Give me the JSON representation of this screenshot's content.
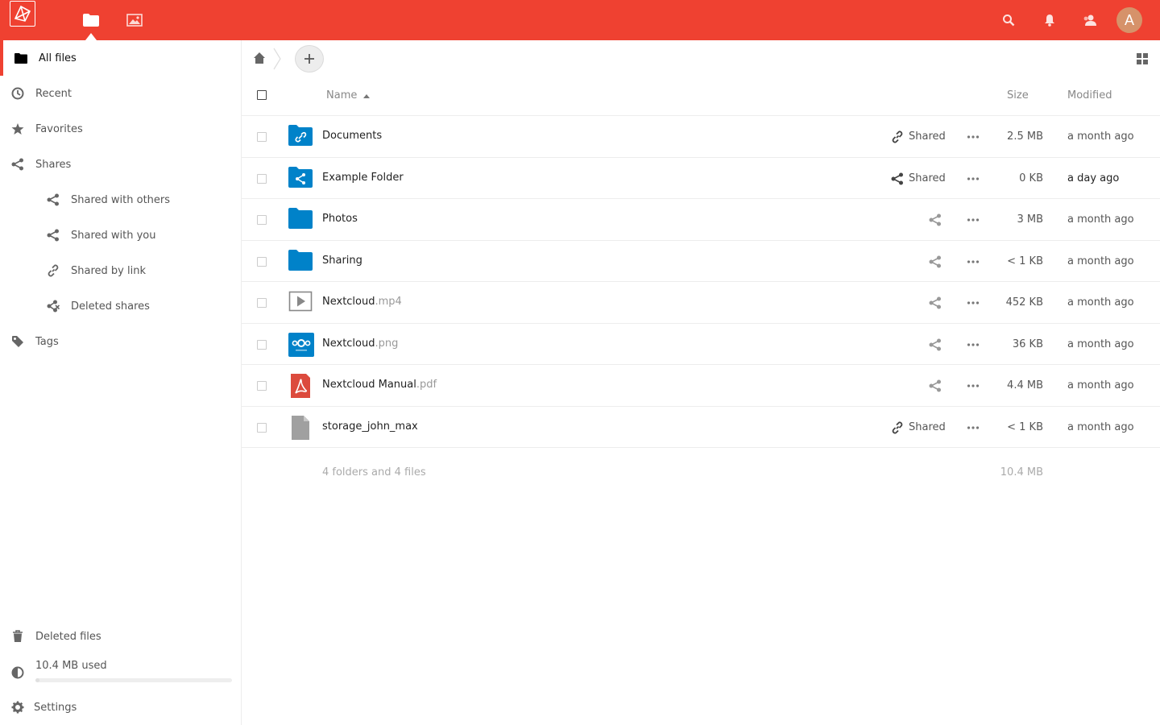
{
  "colors": {
    "brand": "#ef4131",
    "folder": "#0082c9",
    "avatar": "#d6926a"
  },
  "header": {
    "apps": [
      {
        "name": "Files",
        "icon": "folder-icon",
        "active": true
      },
      {
        "name": "Gallery",
        "icon": "image-icon",
        "active": false
      }
    ],
    "right_icons": [
      "search-icon",
      "bell-icon",
      "contacts-icon"
    ],
    "avatar_letter": "A"
  },
  "sidebar": {
    "items": [
      {
        "label": "All files",
        "icon": "folder-icon",
        "active": true
      },
      {
        "label": "Recent",
        "icon": "clock-icon"
      },
      {
        "label": "Favorites",
        "icon": "star-icon"
      },
      {
        "label": "Shares",
        "icon": "share-icon"
      },
      {
        "label": "Shared with others",
        "icon": "share-icon",
        "sub": true
      },
      {
        "label": "Shared with you",
        "icon": "share-icon",
        "sub": true
      },
      {
        "label": "Shared by link",
        "icon": "link-icon",
        "sub": true
      },
      {
        "label": "Deleted shares",
        "icon": "deleted-share-icon",
        "sub": true
      },
      {
        "label": "Tags",
        "icon": "tag-icon"
      }
    ],
    "bottom": {
      "deleted_files": "Deleted files",
      "quota": "10.4 MB used",
      "quota_fraction": 0.02,
      "settings": "Settings"
    }
  },
  "table": {
    "headers": {
      "name": "Name",
      "size": "Size",
      "modified": "Modified"
    },
    "sort": "name-ascending",
    "rows": [
      {
        "name": "Documents",
        "ext": "",
        "icon": "folder-link-icon",
        "shared": "Shared",
        "share_icon": "link-icon",
        "size": "2.5 MB",
        "modified": "a month ago"
      },
      {
        "name": "Example Folder",
        "ext": "",
        "icon": "folder-shared-icon",
        "shared": "Shared",
        "share_icon": "share-icon",
        "size": "0 KB",
        "modified": "a day ago",
        "recent": true
      },
      {
        "name": "Photos",
        "ext": "",
        "icon": "folder-icon",
        "shared": "",
        "share_icon": "share-icon",
        "size": "3 MB",
        "modified": "a month ago"
      },
      {
        "name": "Sharing",
        "ext": "",
        "icon": "folder-icon",
        "shared": "",
        "share_icon": "share-icon",
        "size": "< 1 KB",
        "modified": "a month ago"
      },
      {
        "name": "Nextcloud",
        "ext": ".mp4",
        "icon": "video-icon",
        "shared": "",
        "share_icon": "share-icon",
        "size": "452 KB",
        "modified": "a month ago"
      },
      {
        "name": "Nextcloud",
        "ext": ".png",
        "icon": "nextcloud-image-icon",
        "shared": "",
        "share_icon": "share-icon",
        "size": "36 KB",
        "modified": "a month ago"
      },
      {
        "name": "Nextcloud Manual",
        "ext": ".pdf",
        "icon": "pdf-icon",
        "shared": "",
        "share_icon": "share-icon",
        "size": "4.4 MB",
        "modified": "a month ago"
      },
      {
        "name": "storage_john_max",
        "ext": "",
        "icon": "file-icon",
        "shared": "Shared",
        "share_icon": "link-icon",
        "size": "< 1 KB",
        "modified": "a month ago"
      }
    ],
    "summary": {
      "text": "4 folders and 4 files",
      "size": "10.4 MB"
    }
  }
}
